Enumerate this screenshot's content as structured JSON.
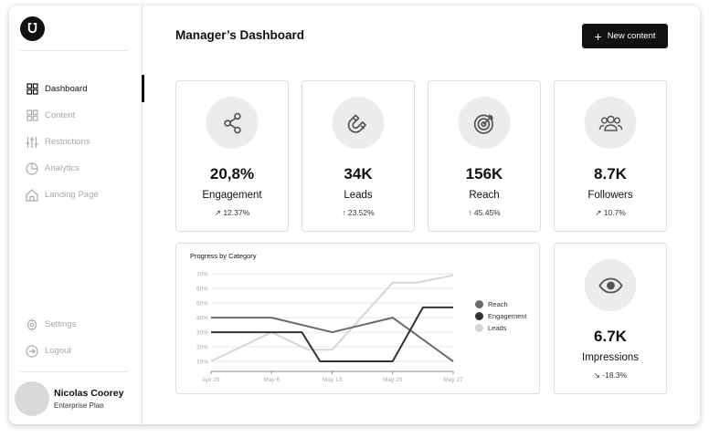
{
  "sidebar": {
    "nav": [
      {
        "label": "Dashboard",
        "icon": "grid-icon",
        "active": true
      },
      {
        "label": "Content",
        "icon": "content-grid-icon",
        "active": false
      },
      {
        "label": "Restrictions",
        "icon": "sliders-icon",
        "active": false
      },
      {
        "label": "Analytics",
        "icon": "pie-chart-icon",
        "active": false
      },
      {
        "label": "Landing Page",
        "icon": "home-icon",
        "active": false
      }
    ],
    "bottom": [
      {
        "label": "Settings",
        "icon": "gear-icon"
      },
      {
        "label": "Logout",
        "icon": "logout-icon"
      }
    ],
    "user": {
      "name": "Nicolas Coorey",
      "plan": "Enterprise Plan"
    }
  },
  "header": {
    "title": "Manager’s Dashboard",
    "new_button": "New content"
  },
  "stats": [
    {
      "value": "20,8%",
      "label": "Engagement",
      "change": "12.37%",
      "icon": "share-icon"
    },
    {
      "value": "34K",
      "label": "Leads",
      "change": "23.52%",
      "icon": "magnet-icon"
    },
    {
      "value": "156K",
      "label": "Reach",
      "change": "45.45%",
      "icon": "target-icon"
    },
    {
      "value": "8.7K",
      "label": "Followers",
      "change": "10.7%",
      "icon": "users-icon"
    }
  ],
  "impressions": {
    "value": "6.7K",
    "label": "Impressions",
    "change": "-18.3%",
    "icon": "eye-icon"
  },
  "colors": {
    "reach": "#6b6b6b",
    "engagement": "#333333",
    "leads": "#d6d6d6",
    "accent": "#111111"
  },
  "chart_data": {
    "type": "line",
    "title": "Progress by Category",
    "x": [
      "Apr 29",
      "May 6",
      "May 13",
      "May 20",
      "May 27"
    ],
    "y_ticks": [
      "10%",
      "20%",
      "30%",
      "40%",
      "50%",
      "60%",
      "70%"
    ],
    "ylim": [
      5,
      72
    ],
    "series": [
      {
        "name": "Reach",
        "points": [
          [
            0,
            40
          ],
          [
            1,
            40
          ],
          [
            2,
            30
          ],
          [
            3,
            40
          ],
          [
            4,
            10
          ]
        ]
      },
      {
        "name": "Engagement",
        "points": [
          [
            0,
            30
          ],
          [
            1.5,
            30
          ],
          [
            1.8,
            10
          ],
          [
            3,
            10
          ],
          [
            3.5,
            47
          ],
          [
            4,
            47
          ]
        ]
      },
      {
        "name": "Leads",
        "points": [
          [
            0,
            10
          ],
          [
            1,
            30
          ],
          [
            1.6,
            18
          ],
          [
            2,
            18
          ],
          [
            3,
            64
          ],
          [
            3.4,
            64
          ],
          [
            4,
            69
          ]
        ]
      }
    ],
    "legend_position": "right"
  }
}
